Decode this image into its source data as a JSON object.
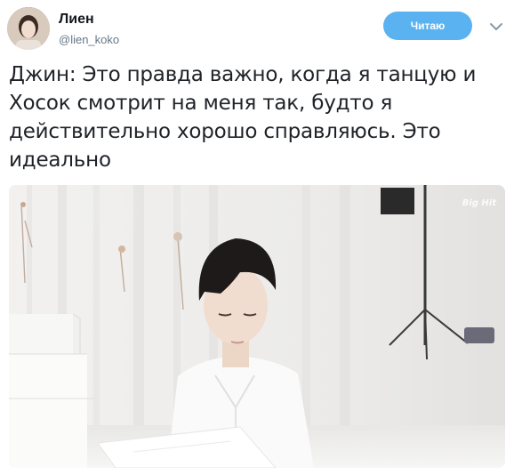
{
  "tweet": {
    "user": {
      "display_name": "Лиен",
      "handle": "@lien_koko"
    },
    "follow_button_label": "Читаю",
    "menu_icon": "chevron-down-icon",
    "text_lines": [
      "Джин: Это правда важно, когда я танцую и",
      "Хосок смотрит на меня так, будто я",
      "действительно хорошо справляюсь. Это",
      "идеально"
    ],
    "media": {
      "watermark": "Big Hit"
    }
  },
  "colors": {
    "follow_button": "#5ab3f0",
    "text": "#1f2327",
    "handle": "#657786"
  }
}
